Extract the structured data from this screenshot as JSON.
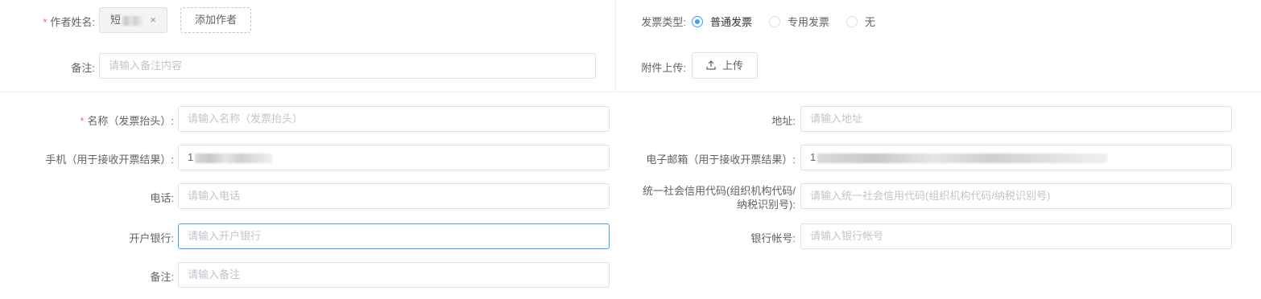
{
  "top_left": {
    "author_label": "作者姓名:",
    "author_required": "*",
    "author_tag_text": "短",
    "author_tag_close": "×",
    "add_author_label": "添加作者",
    "remark_label": "备注:",
    "remark_placeholder": "请输入备注内容"
  },
  "top_right": {
    "invoice_type_label": "发票类型:",
    "options": [
      "普通发票",
      "专用发票",
      "无"
    ],
    "selected": "普通发票",
    "attachment_label": "附件上传:",
    "upload_label": "上传"
  },
  "form": {
    "name_required": "*",
    "name_label": "名称（发票抬头）:",
    "name_placeholder": "请输入名称（发票抬头）",
    "address_label": "地址:",
    "address_placeholder": "请输入地址",
    "phone_label": "手机（用于接收开票结果）:",
    "phone_value": "1",
    "email_label": "电子邮箱（用于接收开票结果）:",
    "email_value": "1",
    "tel_label": "电话:",
    "tel_placeholder": "请输入电话",
    "credit_label_1": "统一社会信用代码(组织机构代码/",
    "credit_label_2": "纳税识别号):",
    "credit_placeholder": "请输入统一社会信用代码(组织机构代码/纳税识别号)",
    "bank_label": "开户银行:",
    "bank_placeholder": "请输入开户银行",
    "account_label": "银行帐号:",
    "account_placeholder": "请输入银行帐号",
    "remark_label": "备注:",
    "remark_placeholder": "请输入备注"
  }
}
